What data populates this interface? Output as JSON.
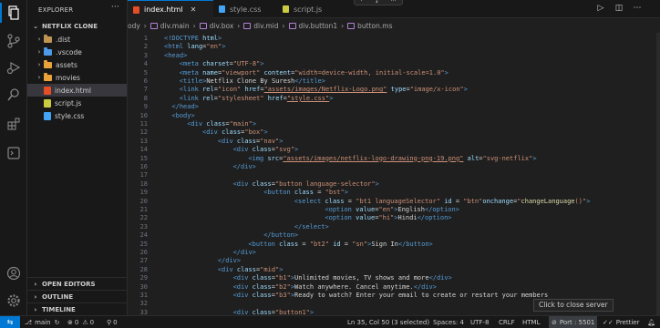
{
  "explorer": {
    "title": "EXPLORER",
    "more": "···",
    "project": "NETFLIX CLONE",
    "tree": [
      {
        "name": ".dist",
        "type": "folder",
        "color": "#c09553"
      },
      {
        "name": ".vscode",
        "type": "folder",
        "color": "#4d9be8"
      },
      {
        "name": "assets",
        "type": "folder",
        "color": "#e9a33a"
      },
      {
        "name": "movies",
        "type": "folder",
        "color": "#e9a33a"
      },
      {
        "name": "index.html",
        "type": "file",
        "color": "#e44d26",
        "selected": true
      },
      {
        "name": "script.js",
        "type": "file",
        "color": "#cbcb41"
      },
      {
        "name": "style.css",
        "type": "file",
        "color": "#42a5f5"
      }
    ],
    "bottom_sections": [
      "OPEN EDITORS",
      "OUTLINE",
      "TIMELINE"
    ]
  },
  "tabs": [
    {
      "label": "index.html",
      "active": true,
      "color": "#e44d26"
    },
    {
      "label": "style.css",
      "active": false,
      "color": "#42a5f5"
    },
    {
      "label": "script.js",
      "active": false,
      "color": "#cbcb41"
    }
  ],
  "breadcrumb": [
    "ody",
    "html",
    "body",
    "div.main",
    "div.box",
    "div.mid",
    "div.button1",
    "button.ms"
  ],
  "code_lines": [
    {
      "n": "1",
      "indent": 0,
      "tokens": [
        [
          "tag",
          "<!DOCTYPE "
        ],
        [
          "attr",
          "html"
        ],
        [
          "tag",
          ">"
        ]
      ]
    },
    {
      "n": "2",
      "indent": 0,
      "tokens": [
        [
          "tag",
          "<html "
        ],
        [
          "attr",
          "lang"
        ],
        [
          "text",
          "="
        ],
        [
          "str",
          "\"en\""
        ],
        [
          "tag",
          ">"
        ]
      ]
    },
    {
      "n": "3",
      "indent": 0,
      "tokens": [
        [
          "tag",
          "<head>"
        ]
      ]
    },
    {
      "n": "4",
      "indent": 2,
      "tokens": [
        [
          "tag",
          "<meta "
        ],
        [
          "attr",
          "charset"
        ],
        [
          "text",
          "="
        ],
        [
          "str",
          "\"UTF-8\""
        ],
        [
          "tag",
          ">"
        ]
      ]
    },
    {
      "n": "5",
      "indent": 2,
      "tokens": [
        [
          "tag",
          "<meta "
        ],
        [
          "attr",
          "name"
        ],
        [
          "text",
          "="
        ],
        [
          "str",
          "\"viewport\""
        ],
        [
          "text",
          " "
        ],
        [
          "attr",
          "content"
        ],
        [
          "text",
          "="
        ],
        [
          "str",
          "\"width=device-width, initial-scale=1.0\""
        ],
        [
          "tag",
          ">"
        ]
      ]
    },
    {
      "n": "6",
      "indent": 2,
      "tokens": [
        [
          "tag",
          "<title>"
        ],
        [
          "text",
          "Netflix Clone By Suresh"
        ],
        [
          "tag",
          "</title>"
        ]
      ]
    },
    {
      "n": "7",
      "indent": 2,
      "tokens": [
        [
          "tag",
          "<link "
        ],
        [
          "attr",
          "rel"
        ],
        [
          "text",
          "="
        ],
        [
          "str",
          "\"icon\""
        ],
        [
          "text",
          " "
        ],
        [
          "attr",
          "href"
        ],
        [
          "text",
          "="
        ],
        [
          "str",
          "\"assets/images/Netflix-Logo.png\""
        ],
        [
          "text",
          " "
        ],
        [
          "attr",
          "type"
        ],
        [
          "text",
          "="
        ],
        [
          "str",
          "\"image/x-icon\""
        ],
        [
          "tag",
          ">"
        ]
      ]
    },
    {
      "n": "8",
      "indent": 2,
      "tokens": [
        [
          "tag",
          "<link "
        ],
        [
          "attr",
          "rel"
        ],
        [
          "text",
          "="
        ],
        [
          "str",
          "\"stylesheet\""
        ],
        [
          "text",
          " "
        ],
        [
          "attr",
          "href"
        ],
        [
          "text",
          "="
        ],
        [
          "str",
          "\"style.css\""
        ],
        [
          "tag",
          ">"
        ]
      ]
    },
    {
      "n": "9",
      "indent": 1,
      "tokens": [
        [
          "tag",
          "</head>"
        ]
      ]
    },
    {
      "n": "10",
      "indent": 1,
      "tokens": [
        [
          "tag",
          "<body>"
        ]
      ]
    },
    {
      "n": "11",
      "indent": 3,
      "tokens": [
        [
          "tag",
          "<div "
        ],
        [
          "attr",
          "class"
        ],
        [
          "text",
          "="
        ],
        [
          "str",
          "\"main\""
        ],
        [
          "tag",
          ">"
        ]
      ]
    },
    {
      "n": "12",
      "indent": 5,
      "tokens": [
        [
          "tag",
          "<div "
        ],
        [
          "attr",
          "class"
        ],
        [
          "text",
          "="
        ],
        [
          "str",
          "\"box\""
        ],
        [
          "tag",
          ">"
        ]
      ]
    },
    {
      "n": "13",
      "indent": 7,
      "tokens": [
        [
          "tag",
          "<div "
        ],
        [
          "attr",
          "class"
        ],
        [
          "text",
          "="
        ],
        [
          "str",
          "\"nav\""
        ],
        [
          "tag",
          ">"
        ]
      ]
    },
    {
      "n": "14",
      "indent": 9,
      "tokens": [
        [
          "tag",
          "<div "
        ],
        [
          "attr",
          "class"
        ],
        [
          "text",
          "="
        ],
        [
          "str",
          "\"svg\""
        ],
        [
          "tag",
          ">"
        ]
      ]
    },
    {
      "n": "15",
      "indent": 11,
      "tokens": [
        [
          "tag",
          "<img "
        ],
        [
          "attr",
          "src"
        ],
        [
          "text",
          "="
        ],
        [
          "str",
          "\"assets/images/netflix-logo-drawing-png-19.png\""
        ],
        [
          "text",
          " "
        ],
        [
          "attr",
          "alt"
        ],
        [
          "text",
          "="
        ],
        [
          "str",
          "\"svg-netflix\""
        ],
        [
          "tag",
          ">"
        ]
      ]
    },
    {
      "n": "16",
      "indent": 9,
      "tokens": [
        [
          "tag",
          "</div>"
        ]
      ]
    },
    {
      "n": "17",
      "indent": 0,
      "tokens": []
    },
    {
      "n": "18",
      "indent": 9,
      "tokens": [
        [
          "tag",
          "<div "
        ],
        [
          "attr",
          "class"
        ],
        [
          "text",
          "="
        ],
        [
          "str",
          "\"button language-selector\""
        ],
        [
          "tag",
          ">"
        ]
      ]
    },
    {
      "n": "19",
      "indent": 13,
      "tokens": [
        [
          "tag",
          "<button "
        ],
        [
          "attr",
          "class"
        ],
        [
          "text",
          " = "
        ],
        [
          "str",
          "\"bst\""
        ],
        [
          "tag",
          ">"
        ]
      ]
    },
    {
      "n": "20",
      "indent": 17,
      "tokens": [
        [
          "tag",
          "<select "
        ],
        [
          "attr",
          "class"
        ],
        [
          "text",
          " = "
        ],
        [
          "str",
          "\"bt1 languageSelector\""
        ],
        [
          "text",
          " "
        ],
        [
          "attr",
          "id"
        ],
        [
          "text",
          " = "
        ],
        [
          "str",
          "\"btn\""
        ],
        [
          "attr",
          "onchange"
        ],
        [
          "text",
          "="
        ],
        [
          "str",
          "\""
        ],
        [
          "fn",
          "changeLanguage"
        ],
        [
          "str",
          "()\""
        ],
        [
          "tag",
          ">"
        ]
      ]
    },
    {
      "n": "21",
      "indent": 21,
      "tokens": [
        [
          "tag",
          "<option "
        ],
        [
          "attr",
          "value"
        ],
        [
          "text",
          "="
        ],
        [
          "str",
          "\"en\""
        ],
        [
          "tag",
          ">"
        ],
        [
          "text",
          "English"
        ],
        [
          "tag",
          "</option>"
        ]
      ]
    },
    {
      "n": "22",
      "indent": 21,
      "tokens": [
        [
          "tag",
          "<option "
        ],
        [
          "attr",
          "value"
        ],
        [
          "text",
          "="
        ],
        [
          "str",
          "\"hi\""
        ],
        [
          "tag",
          ">"
        ],
        [
          "text",
          "Hindi"
        ],
        [
          "tag",
          "</option>"
        ]
      ]
    },
    {
      "n": "23",
      "indent": 17,
      "tokens": [
        [
          "tag",
          "</select>"
        ]
      ]
    },
    {
      "n": "24",
      "indent": 13,
      "tokens": [
        [
          "tag",
          "</button>"
        ]
      ]
    },
    {
      "n": "25",
      "indent": 11,
      "tokens": [
        [
          "tag",
          "<button "
        ],
        [
          "attr",
          "class"
        ],
        [
          "text",
          " = "
        ],
        [
          "str",
          "\"bt2\""
        ],
        [
          "text",
          " "
        ],
        [
          "attr",
          "id"
        ],
        [
          "text",
          " = "
        ],
        [
          "str",
          "\"sn\""
        ],
        [
          "tag",
          ">"
        ],
        [
          "text",
          "Sign In"
        ],
        [
          "tag",
          "</button>"
        ]
      ]
    },
    {
      "n": "26",
      "indent": 9,
      "tokens": [
        [
          "tag",
          "</div>"
        ]
      ]
    },
    {
      "n": "27",
      "indent": 7,
      "tokens": [
        [
          "tag",
          "</div>"
        ]
      ]
    },
    {
      "n": "28",
      "indent": 7,
      "tokens": [
        [
          "tag",
          "<div "
        ],
        [
          "attr",
          "class"
        ],
        [
          "text",
          "="
        ],
        [
          "str",
          "\"mid\""
        ],
        [
          "tag",
          ">"
        ]
      ]
    },
    {
      "n": "29",
      "indent": 9,
      "tokens": [
        [
          "tag",
          "<div "
        ],
        [
          "attr",
          "class"
        ],
        [
          "text",
          "="
        ],
        [
          "str",
          "\"b1\""
        ],
        [
          "tag",
          ">"
        ],
        [
          "text",
          "Unlimited movies, TV shows and more"
        ],
        [
          "tag",
          "</div>"
        ]
      ]
    },
    {
      "n": "30",
      "indent": 9,
      "tokens": [
        [
          "tag",
          "<div "
        ],
        [
          "attr",
          "class"
        ],
        [
          "text",
          "="
        ],
        [
          "str",
          "\"b2\""
        ],
        [
          "tag",
          ">"
        ],
        [
          "text",
          "Watch anywhere. Cancel anytime."
        ],
        [
          "tag",
          "</div>"
        ]
      ]
    },
    {
      "n": "31",
      "indent": 9,
      "tokens": [
        [
          "tag",
          "<div "
        ],
        [
          "attr",
          "class"
        ],
        [
          "text",
          "="
        ],
        [
          "str",
          "\"b3\""
        ],
        [
          "tag",
          ">"
        ],
        [
          "text",
          "Ready to watch? Enter your email to create or restart your members"
        ]
      ]
    },
    {
      "n": "32",
      "indent": 0,
      "tokens": []
    },
    {
      "n": "33",
      "indent": 9,
      "tokens": [
        [
          "tag",
          "<div "
        ],
        [
          "attr",
          "class"
        ],
        [
          "text",
          "="
        ],
        [
          "str",
          "\"button1\""
        ],
        [
          "tag",
          ">"
        ]
      ]
    }
  ],
  "floating_toolbar": [
    "·",
    "↕",
    "···"
  ],
  "tooltip": "Click to close server",
  "status": {
    "branch": "main",
    "errors": "0",
    "warnings": "0",
    "ports": "0",
    "position": "Ln 35, Col 50 (3 selected)",
    "spaces": "Spaces: 4",
    "encoding": "UTF-8",
    "eol": "CRLF",
    "language": "HTML",
    "port": "Port : 5501",
    "formatter": "Prettier"
  },
  "colors": {
    "accent": "#0078d4"
  }
}
